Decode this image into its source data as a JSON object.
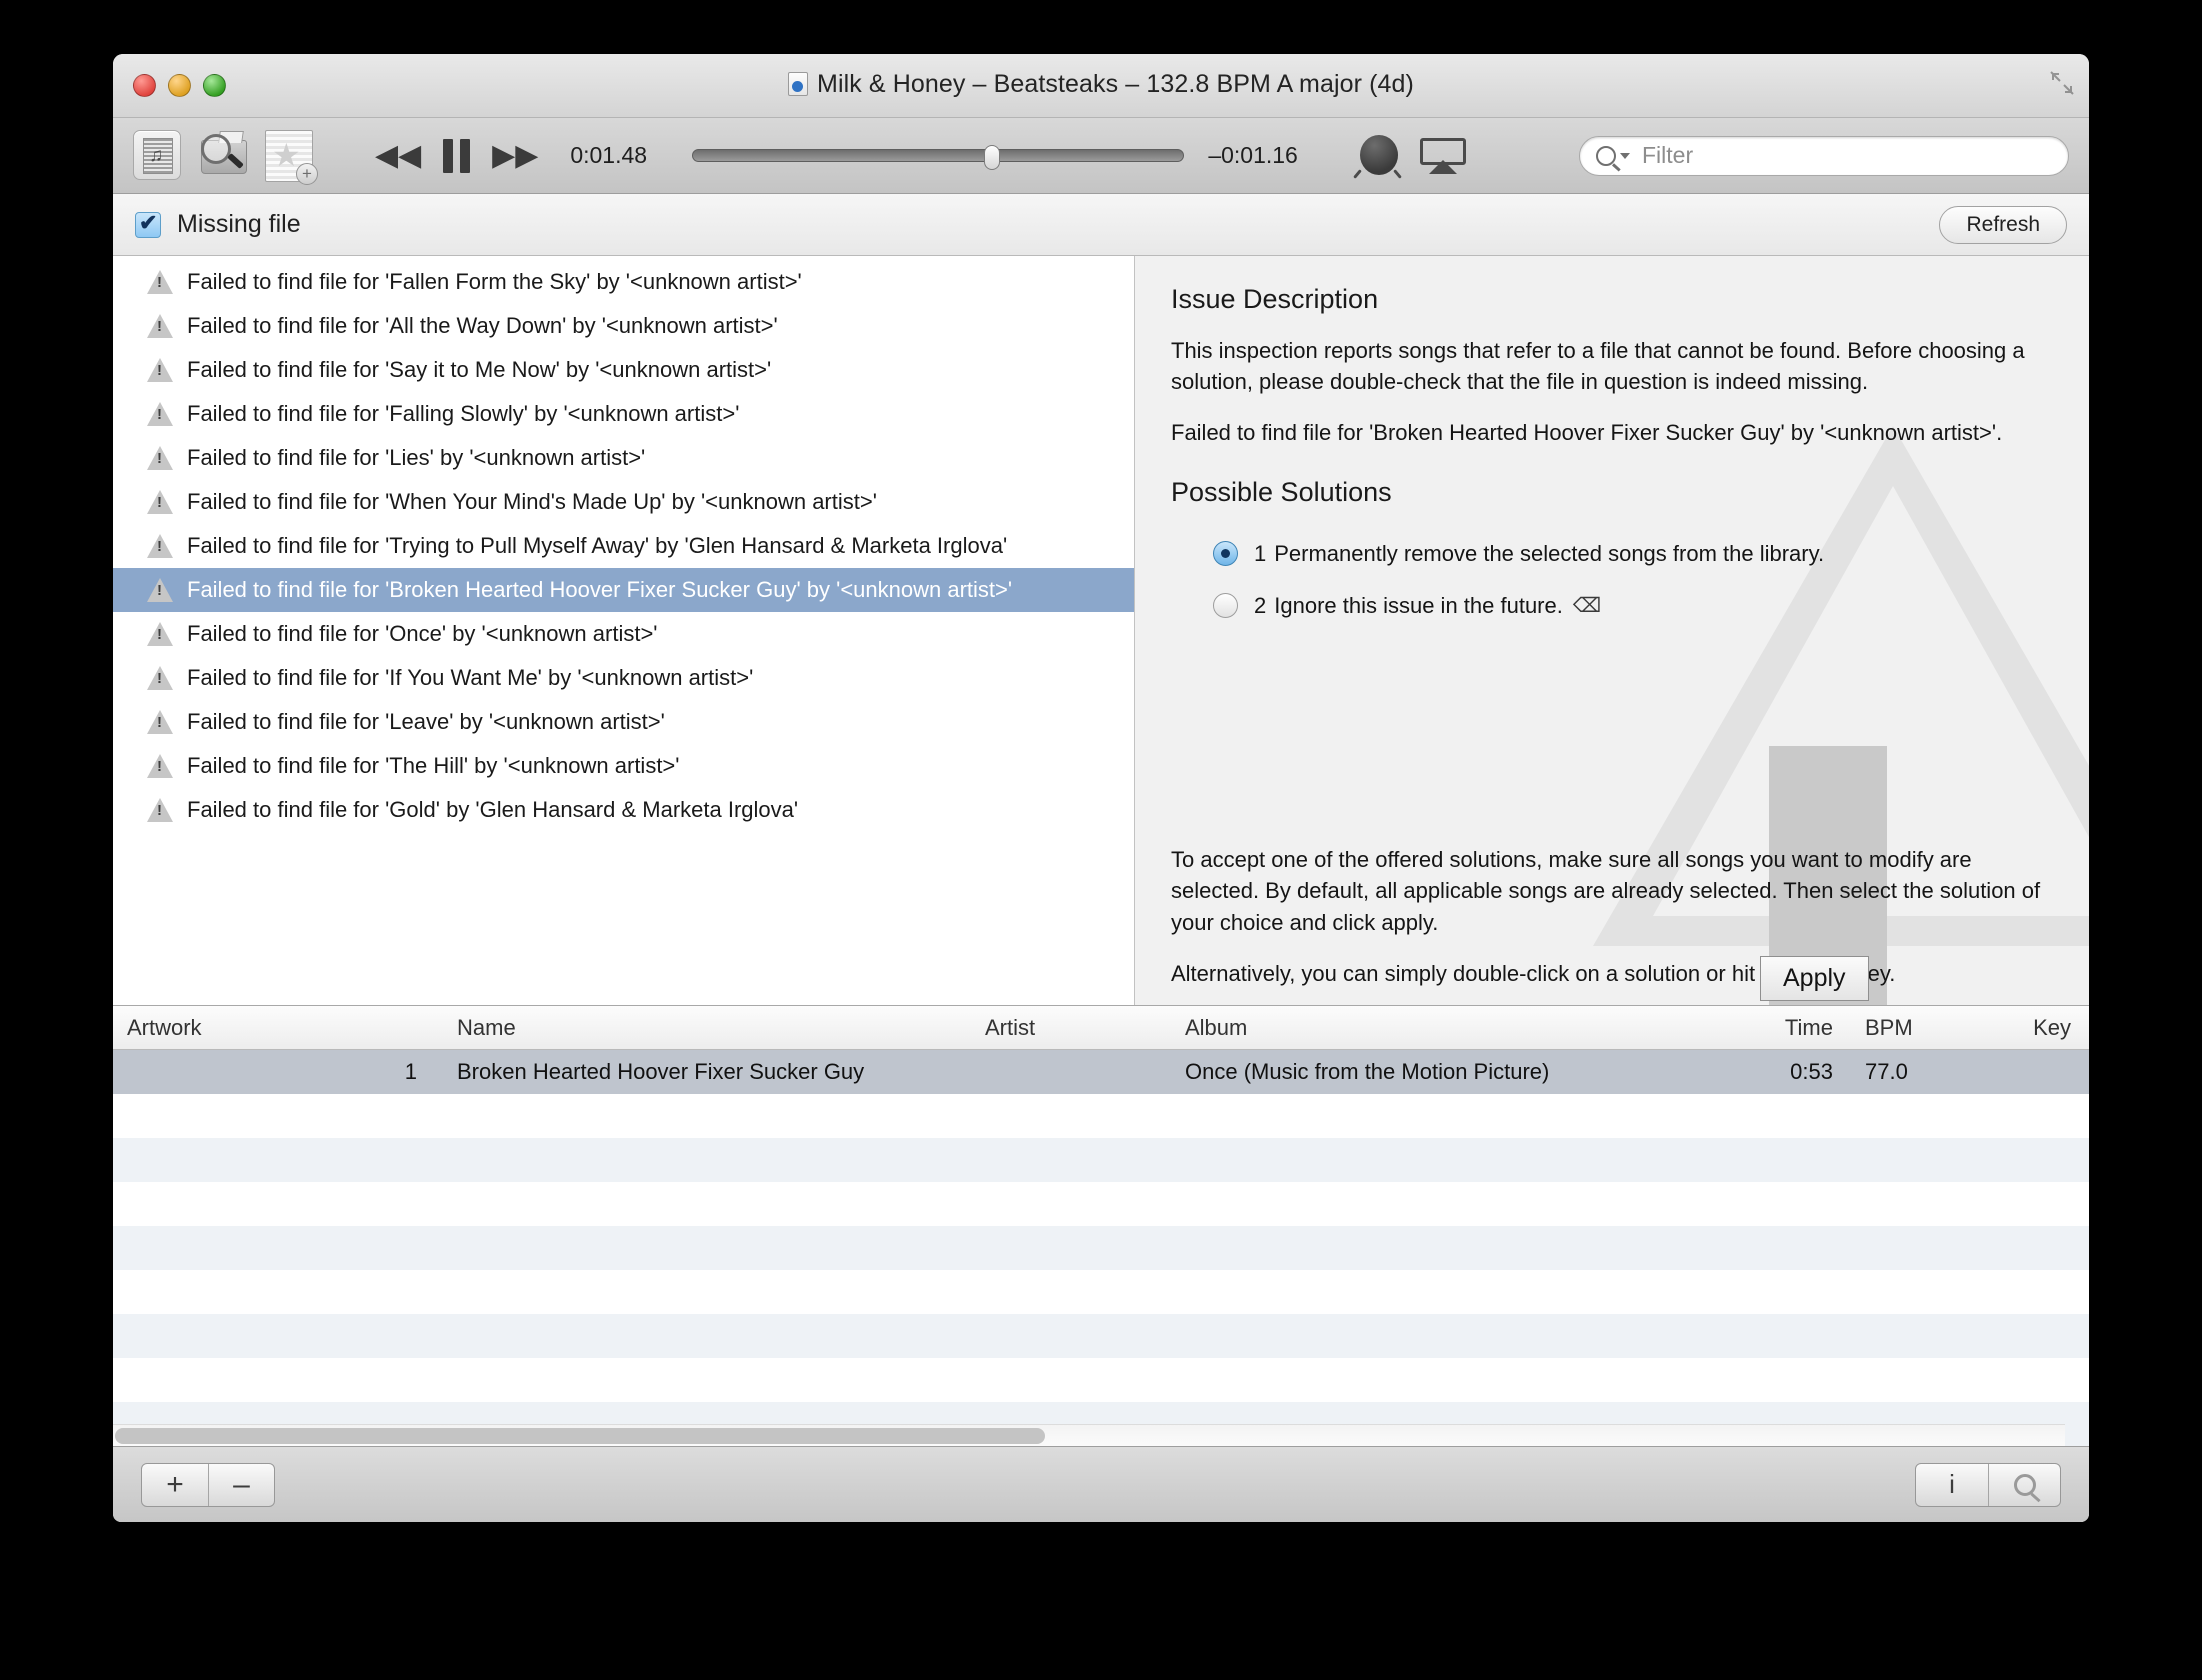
{
  "window": {
    "title": "Milk & Honey – Beatsteaks – 132.8 BPM A major (4d)",
    "doc_icon": "audio-document-icon",
    "traffic_lights": [
      "close",
      "minimize",
      "zoom"
    ]
  },
  "toolbar": {
    "icons": [
      {
        "name": "song-info-icon",
        "label": "Song Info"
      },
      {
        "name": "find-folder-icon",
        "label": "Find Folder"
      },
      {
        "name": "new-smart-playlist-icon",
        "label": "New Smart Playlist"
      }
    ],
    "transport": {
      "rewind_icon": "rewind-icon",
      "pause_icon": "pause-icon",
      "forward_icon": "fast-forward-icon",
      "elapsed": "0:01.48",
      "remaining": "–0:01.16",
      "progress_percent": 59
    },
    "knob_icon": "volume-knob-icon",
    "airplay_icon": "airplay-icon",
    "filter": {
      "icon": "search-icon",
      "placeholder": "Filter",
      "value": ""
    }
  },
  "inspection_bar": {
    "checkbox_checked": true,
    "label": "Missing file",
    "refresh_label": "Refresh"
  },
  "issue_list": {
    "icon": "warning-triangle-icon",
    "selected_index": 7,
    "items": [
      "Failed to find file for 'Fallen Form the Sky' by '<unknown artist>'",
      "Failed to find file for 'All the Way Down' by '<unknown artist>'",
      "Failed to find file for 'Say it to Me Now' by '<unknown artist>'",
      "Failed to find file for 'Falling Slowly' by '<unknown artist>'",
      "Failed to find file for 'Lies' by '<unknown artist>'",
      "Failed to find file for 'When Your Mind's Made Up' by '<unknown artist>'",
      "Failed to find file for 'Trying to Pull Myself Away' by 'Glen Hansard & Marketa Irglova'",
      "Failed to find file for 'Broken Hearted Hoover Fixer Sucker Guy' by '<unknown artist>'",
      "Failed to find file for 'Once' by '<unknown artist>'",
      "Failed to find file for 'If You Want Me' by '<unknown artist>'",
      "Failed to find file for 'Leave' by '<unknown artist>'",
      "Failed to find file for 'The Hill' by '<unknown artist>'",
      "Failed to find file for 'Gold' by 'Glen Hansard & Marketa Irglova'"
    ]
  },
  "detail": {
    "issue_heading": "Issue Description",
    "issue_body": "This inspection reports songs that refer to a file that cannot be found. Before choosing a solution, please double-check that the file in question is indeed missing.",
    "issue_specific": "Failed to find file for 'Broken Hearted Hoover Fixer Sucker Guy' by '<unknown artist>'.",
    "solutions_heading": "Possible Solutions",
    "solutions": [
      {
        "num": "1",
        "text": "Permanently remove the selected songs from the library.",
        "selected": true,
        "key_hint": ""
      },
      {
        "num": "2",
        "text": "Ignore this issue in the future.",
        "selected": false,
        "key_hint": "⌫"
      }
    ],
    "apply_label": "Apply",
    "help_paragraph_1": "To accept one of the offered solutions, make sure all songs you want to modify are selected. By default, all applicable songs are already selected. Then select the solution of your choice and click apply.",
    "help_paragraph_2": "Alternatively, you can simply double-click on a solution or hit the Enter key.",
    "watermark_icon": "warning-triangle-watermark"
  },
  "track_table": {
    "columns": [
      "Artwork",
      "Name",
      "Artist",
      "Album",
      "Time",
      "BPM",
      "Key"
    ],
    "rows": [
      {
        "artwork": "1",
        "name": "Broken Hearted Hoover Fixer Sucker Guy",
        "artist": "",
        "album": "Once (Music from the Motion Picture)",
        "time": "0:53",
        "bpm": "77.0",
        "key": "",
        "selected": true
      }
    ],
    "empty_row_count": 8
  },
  "bottom_bar": {
    "add_label": "+",
    "remove_label": "–",
    "info_label": "i",
    "search_icon": "magnifier-icon"
  }
}
